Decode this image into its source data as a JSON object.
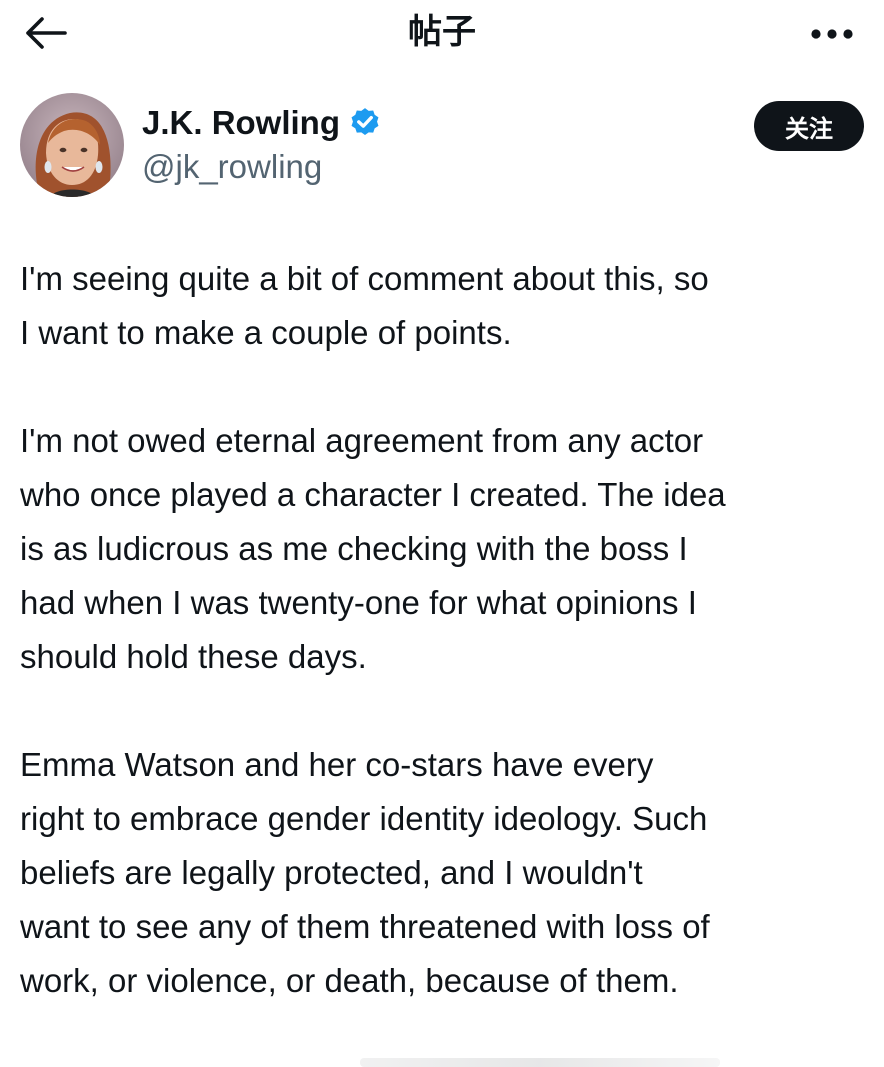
{
  "header": {
    "title": "帖子",
    "back_icon": "arrow-left-icon",
    "more_icon": "more-horizontal-icon"
  },
  "author": {
    "display_name": "J.K. Rowling",
    "handle": "@jk_rowling",
    "verified": true,
    "verified_color": "#1d9bf0",
    "follow_label": "关注"
  },
  "post": {
    "paragraphs": [
      "I'm seeing quite a bit of comment about this, so\nI want to make a couple of points.",
      "I'm not owed eternal agreement from any actor\nwho once played a character I created. The idea\nis as ludicrous as me checking with the boss I\nhad when I was twenty-one for what opinions I\nshould hold these days.",
      "Emma Watson and her co-stars have every\nright to embrace gender identity ideology. Such\nbeliefs are legally protected, and I wouldn't\nwant to see any of them threatened with loss of\nwork, or violence, or death, because of them."
    ]
  },
  "colors": {
    "text_primary": "#0f1419",
    "text_secondary": "#536471",
    "button_bg": "#0f1419",
    "button_text": "#ffffff",
    "background": "#ffffff"
  }
}
